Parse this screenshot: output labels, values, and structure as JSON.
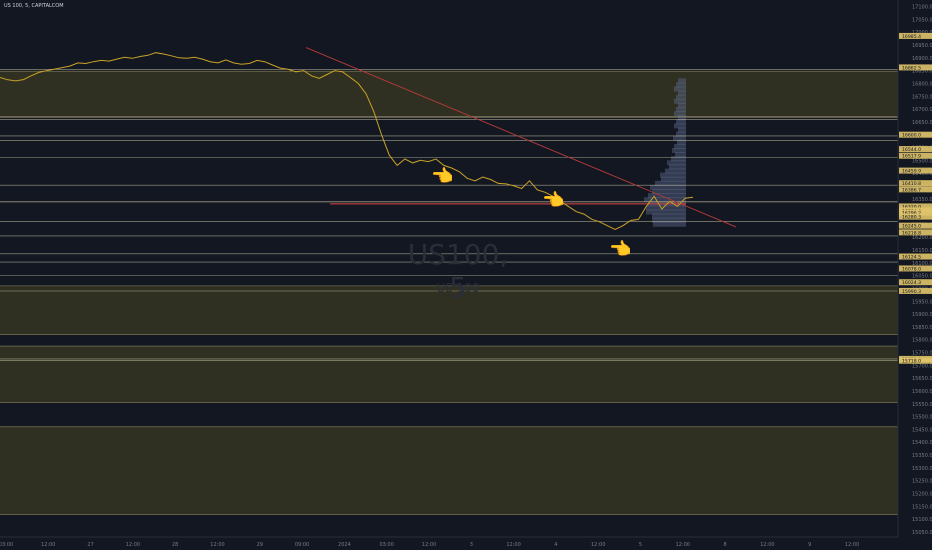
{
  "header": {
    "symbol": "US 100, 5, CAPITALCOM"
  },
  "watermark": {
    "ticker": "US100, 5",
    "name": "US 100"
  },
  "pointers": [
    {
      "icon": "pointing-left-hand-icon",
      "glyph": "👈"
    },
    {
      "icon": "pointing-left-hand-icon",
      "glyph": "👈"
    },
    {
      "icon": "pointing-left-hand-icon",
      "glyph": "👈"
    }
  ],
  "chart_data": {
    "type": "line",
    "colors": {
      "price_line": "#c9a227",
      "background": "#131722",
      "trend_line": "#b83a3a",
      "level_line": "#c7c1a0",
      "demand_zone": "#3a3a22",
      "volume_profile": "#5d6a8c"
    },
    "x_tick_labels": [
      "03:00",
      "12:00",
      "27",
      "12:00",
      "28",
      "12:00",
      "29",
      "09:00",
      "2024",
      "03:00",
      "12:00",
      "3",
      "12:00",
      "4",
      "12:00",
      "5",
      "12:00",
      "8",
      "12:00",
      "9",
      "12:00"
    ],
    "y_ticks": [
      17100,
      17050,
      17000,
      16950,
      16900,
      16850,
      16800,
      16750,
      16700,
      16650,
      16600,
      16550,
      16500,
      16450,
      16400,
      16350,
      16300,
      16250,
      16200,
      16150,
      16100,
      16050,
      16000,
      15950,
      15900,
      15850,
      15800,
      15750,
      15700,
      15650,
      15600,
      15550,
      15500,
      15450,
      15400,
      15350,
      15300,
      15250,
      15200,
      15150,
      15100,
      15050
    ],
    "ylim": [
      15030,
      17110
    ],
    "price_series": [
      [
        0,
        16823
      ],
      [
        2,
        16814
      ],
      [
        4,
        16810
      ],
      [
        6,
        16815
      ],
      [
        8,
        16830
      ],
      [
        10,
        16843
      ],
      [
        12,
        16850
      ],
      [
        14,
        16856
      ],
      [
        16,
        16862
      ],
      [
        18,
        16868
      ],
      [
        20,
        16880
      ],
      [
        22,
        16878
      ],
      [
        24,
        16885
      ],
      [
        26,
        16890
      ],
      [
        28,
        16887
      ],
      [
        30,
        16895
      ],
      [
        32,
        16902
      ],
      [
        34,
        16898
      ],
      [
        36,
        16905
      ],
      [
        38,
        16910
      ],
      [
        40,
        16920
      ],
      [
        42,
        16915
      ],
      [
        44,
        16908
      ],
      [
        46,
        16900
      ],
      [
        48,
        16898
      ],
      [
        50,
        16902
      ],
      [
        52,
        16895
      ],
      [
        54,
        16885
      ],
      [
        56,
        16880
      ],
      [
        58,
        16892
      ],
      [
        60,
        16880
      ],
      [
        62,
        16875
      ],
      [
        64,
        16878
      ],
      [
        66,
        16890
      ],
      [
        68,
        16885
      ],
      [
        70,
        16872
      ],
      [
        72,
        16860
      ],
      [
        74,
        16855
      ],
      [
        76,
        16845
      ],
      [
        78,
        16850
      ],
      [
        80,
        16830
      ],
      [
        82,
        16820
      ],
      [
        84,
        16835
      ],
      [
        86,
        16850
      ],
      [
        88,
        16845
      ],
      [
        90,
        16823
      ],
      [
        92,
        16800
      ],
      [
        94,
        16760
      ],
      [
        96,
        16690
      ],
      [
        98,
        16600
      ],
      [
        100,
        16520
      ],
      [
        102,
        16480
      ],
      [
        104,
        16505
      ],
      [
        106,
        16490
      ],
      [
        108,
        16500
      ],
      [
        110,
        16495
      ],
      [
        112,
        16505
      ],
      [
        114,
        16480
      ],
      [
        116,
        16470
      ],
      [
        118,
        16455
      ],
      [
        120,
        16430
      ],
      [
        122,
        16420
      ],
      [
        124,
        16435
      ],
      [
        126,
        16425
      ],
      [
        128,
        16410
      ],
      [
        130,
        16408
      ],
      [
        132,
        16400
      ],
      [
        134,
        16390
      ],
      [
        136,
        16420
      ],
      [
        138,
        16385
      ],
      [
        140,
        16375
      ],
      [
        142,
        16360
      ],
      [
        144,
        16340
      ],
      [
        146,
        16320
      ],
      [
        148,
        16300
      ],
      [
        150,
        16290
      ],
      [
        152,
        16270
      ],
      [
        154,
        16260
      ],
      [
        156,
        16245
      ],
      [
        158,
        16230
      ],
      [
        160,
        16245
      ],
      [
        162,
        16265
      ],
      [
        164,
        16270
      ],
      [
        166,
        16320
      ],
      [
        168,
        16360
      ],
      [
        170,
        16310
      ],
      [
        172,
        16340
      ],
      [
        174,
        16320
      ],
      [
        176,
        16352
      ],
      [
        178,
        16356
      ]
    ],
    "levels": [
      16855,
      16672,
      16660,
      16595,
      16578,
      16512,
      16403,
      16338,
      16338,
      16262,
      16205,
      16135,
      16103,
      16050,
      15990,
      15725,
      15718
    ],
    "red_level": 16330,
    "price_labels": [
      "16985.4",
      "16862.5",
      "16600.0",
      "16544.0",
      "16517.9",
      "16459.9",
      "16410.8",
      "16386.7",
      "16320.0",
      "16304.4",
      "16296.2",
      "16280.3",
      "16245.0",
      "16218.8",
      "16124.5",
      "16078.0",
      "16024.3",
      "15990.3",
      "15725.0",
      "15718.0"
    ],
    "zones": [
      [
        16848,
        16668
      ],
      [
        16010,
        15820
      ],
      [
        15775,
        15555
      ],
      [
        15460,
        15118
      ]
    ]
  }
}
